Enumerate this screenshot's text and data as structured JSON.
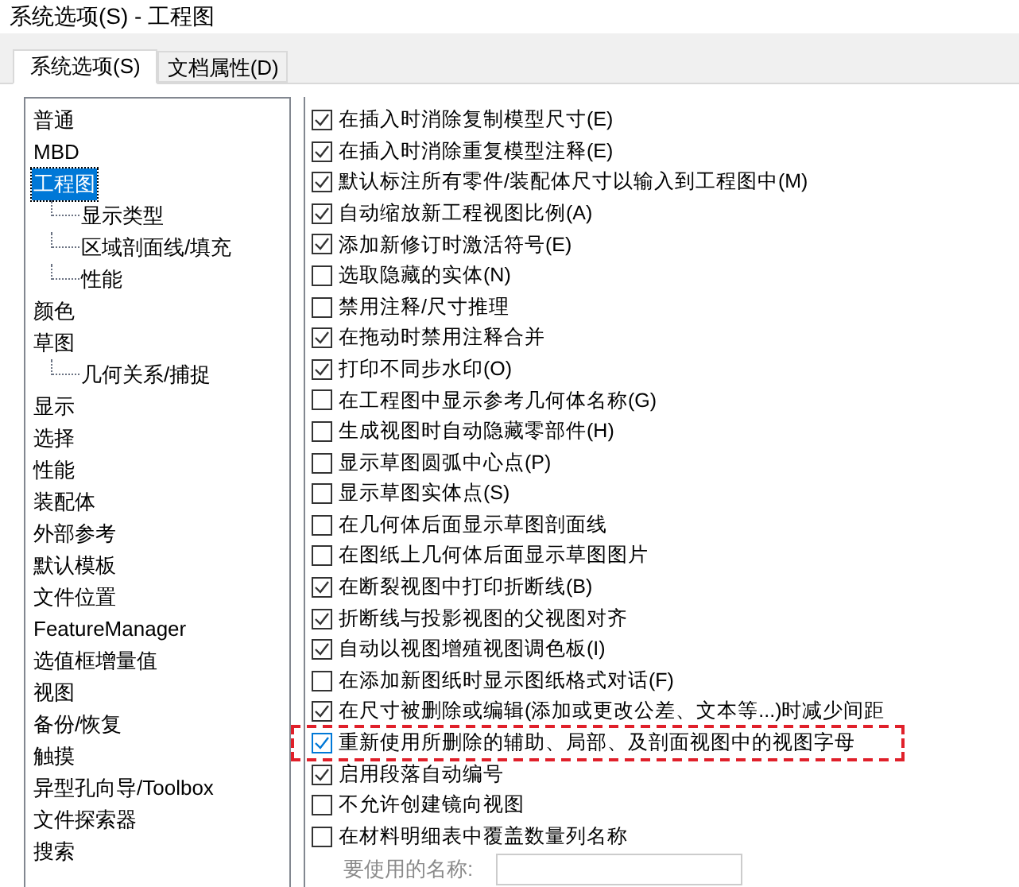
{
  "window": {
    "title": "系统选项(S) - 工程图"
  },
  "tabs": [
    {
      "label": "系统选项(S)",
      "selected": true
    },
    {
      "label": "文档属性(D)",
      "selected": false
    }
  ],
  "sidebar": {
    "items": [
      {
        "label": "普通",
        "selected": false
      },
      {
        "label": "MBD",
        "selected": false
      },
      {
        "label": "工程图",
        "selected": true,
        "children": [
          {
            "label": "显示类型",
            "selected": false
          },
          {
            "label": "区域剖面线/填充",
            "selected": false
          },
          {
            "label": "性能",
            "selected": false
          }
        ]
      },
      {
        "label": "颜色",
        "selected": false
      },
      {
        "label": "草图",
        "selected": false,
        "children": [
          {
            "label": "几何关系/捕捉",
            "selected": false
          }
        ]
      },
      {
        "label": "显示",
        "selected": false
      },
      {
        "label": "选择",
        "selected": false
      },
      {
        "label": "性能",
        "selected": false
      },
      {
        "label": "装配体",
        "selected": false
      },
      {
        "label": "外部参考",
        "selected": false
      },
      {
        "label": "默认模板",
        "selected": false
      },
      {
        "label": "文件位置",
        "selected": false
      },
      {
        "label": "FeatureManager",
        "selected": false
      },
      {
        "label": "选值框增量值",
        "selected": false
      },
      {
        "label": "视图",
        "selected": false
      },
      {
        "label": "备份/恢复",
        "selected": false
      },
      {
        "label": "触摸",
        "selected": false
      },
      {
        "label": "异型孔向导/Toolbox",
        "selected": false
      },
      {
        "label": "文件探索器",
        "selected": false
      },
      {
        "label": "搜索",
        "selected": false
      }
    ]
  },
  "options": [
    {
      "label": "在插入时消除复制模型尺寸(E)",
      "checked": true,
      "highlighted": false
    },
    {
      "label": "在插入时消除重复模型注释(E)",
      "checked": true,
      "highlighted": false
    },
    {
      "label": "默认标注所有零件/装配体尺寸以输入到工程图中(M)",
      "checked": true,
      "highlighted": false
    },
    {
      "label": "自动缩放新工程视图比例(A)",
      "checked": true,
      "highlighted": false
    },
    {
      "label": "添加新修订时激活符号(E)",
      "checked": true,
      "highlighted": false
    },
    {
      "label": "选取隐藏的实体(N)",
      "checked": false,
      "highlighted": false
    },
    {
      "label": "禁用注释/尺寸推理",
      "checked": false,
      "highlighted": false
    },
    {
      "label": "在拖动时禁用注释合并",
      "checked": true,
      "highlighted": false
    },
    {
      "label": "打印不同步水印(O)",
      "checked": true,
      "highlighted": false
    },
    {
      "label": "在工程图中显示参考几何体名称(G)",
      "checked": false,
      "highlighted": false
    },
    {
      "label": "生成视图时自动隐藏零部件(H)",
      "checked": false,
      "highlighted": false
    },
    {
      "label": "显示草图圆弧中心点(P)",
      "checked": false,
      "highlighted": false
    },
    {
      "label": "显示草图实体点(S)",
      "checked": false,
      "highlighted": false
    },
    {
      "label": "在几何体后面显示草图剖面线",
      "checked": false,
      "highlighted": false
    },
    {
      "label": "在图纸上几何体后面显示草图图片",
      "checked": false,
      "highlighted": false
    },
    {
      "label": "在断裂视图中打印折断线(B)",
      "checked": true,
      "highlighted": false
    },
    {
      "label": "折断线与投影视图的父视图对齐",
      "checked": true,
      "highlighted": false
    },
    {
      "label": "自动以视图增殖视图调色板(I)",
      "checked": true,
      "highlighted": false
    },
    {
      "label": "在添加新图纸时显示图纸格式对话(F)",
      "checked": false,
      "highlighted": false
    },
    {
      "label": "在尺寸被删除或编辑(添加或更改公差、文本等...)时减少间距",
      "checked": true,
      "highlighted": false
    },
    {
      "label": "重新使用所删除的辅助、局部、及剖面视图中的视图字母",
      "checked": true,
      "highlighted": true
    },
    {
      "label": "启用段落自动编号",
      "checked": true,
      "highlighted": false
    },
    {
      "label": "不允许创建镜向视图",
      "checked": false,
      "highlighted": false
    },
    {
      "label": "在材料明细表中覆盖数量列名称",
      "checked": false,
      "highlighted": false
    }
  ],
  "name_field": {
    "label": "要使用的名称:",
    "disabled": true
  }
}
